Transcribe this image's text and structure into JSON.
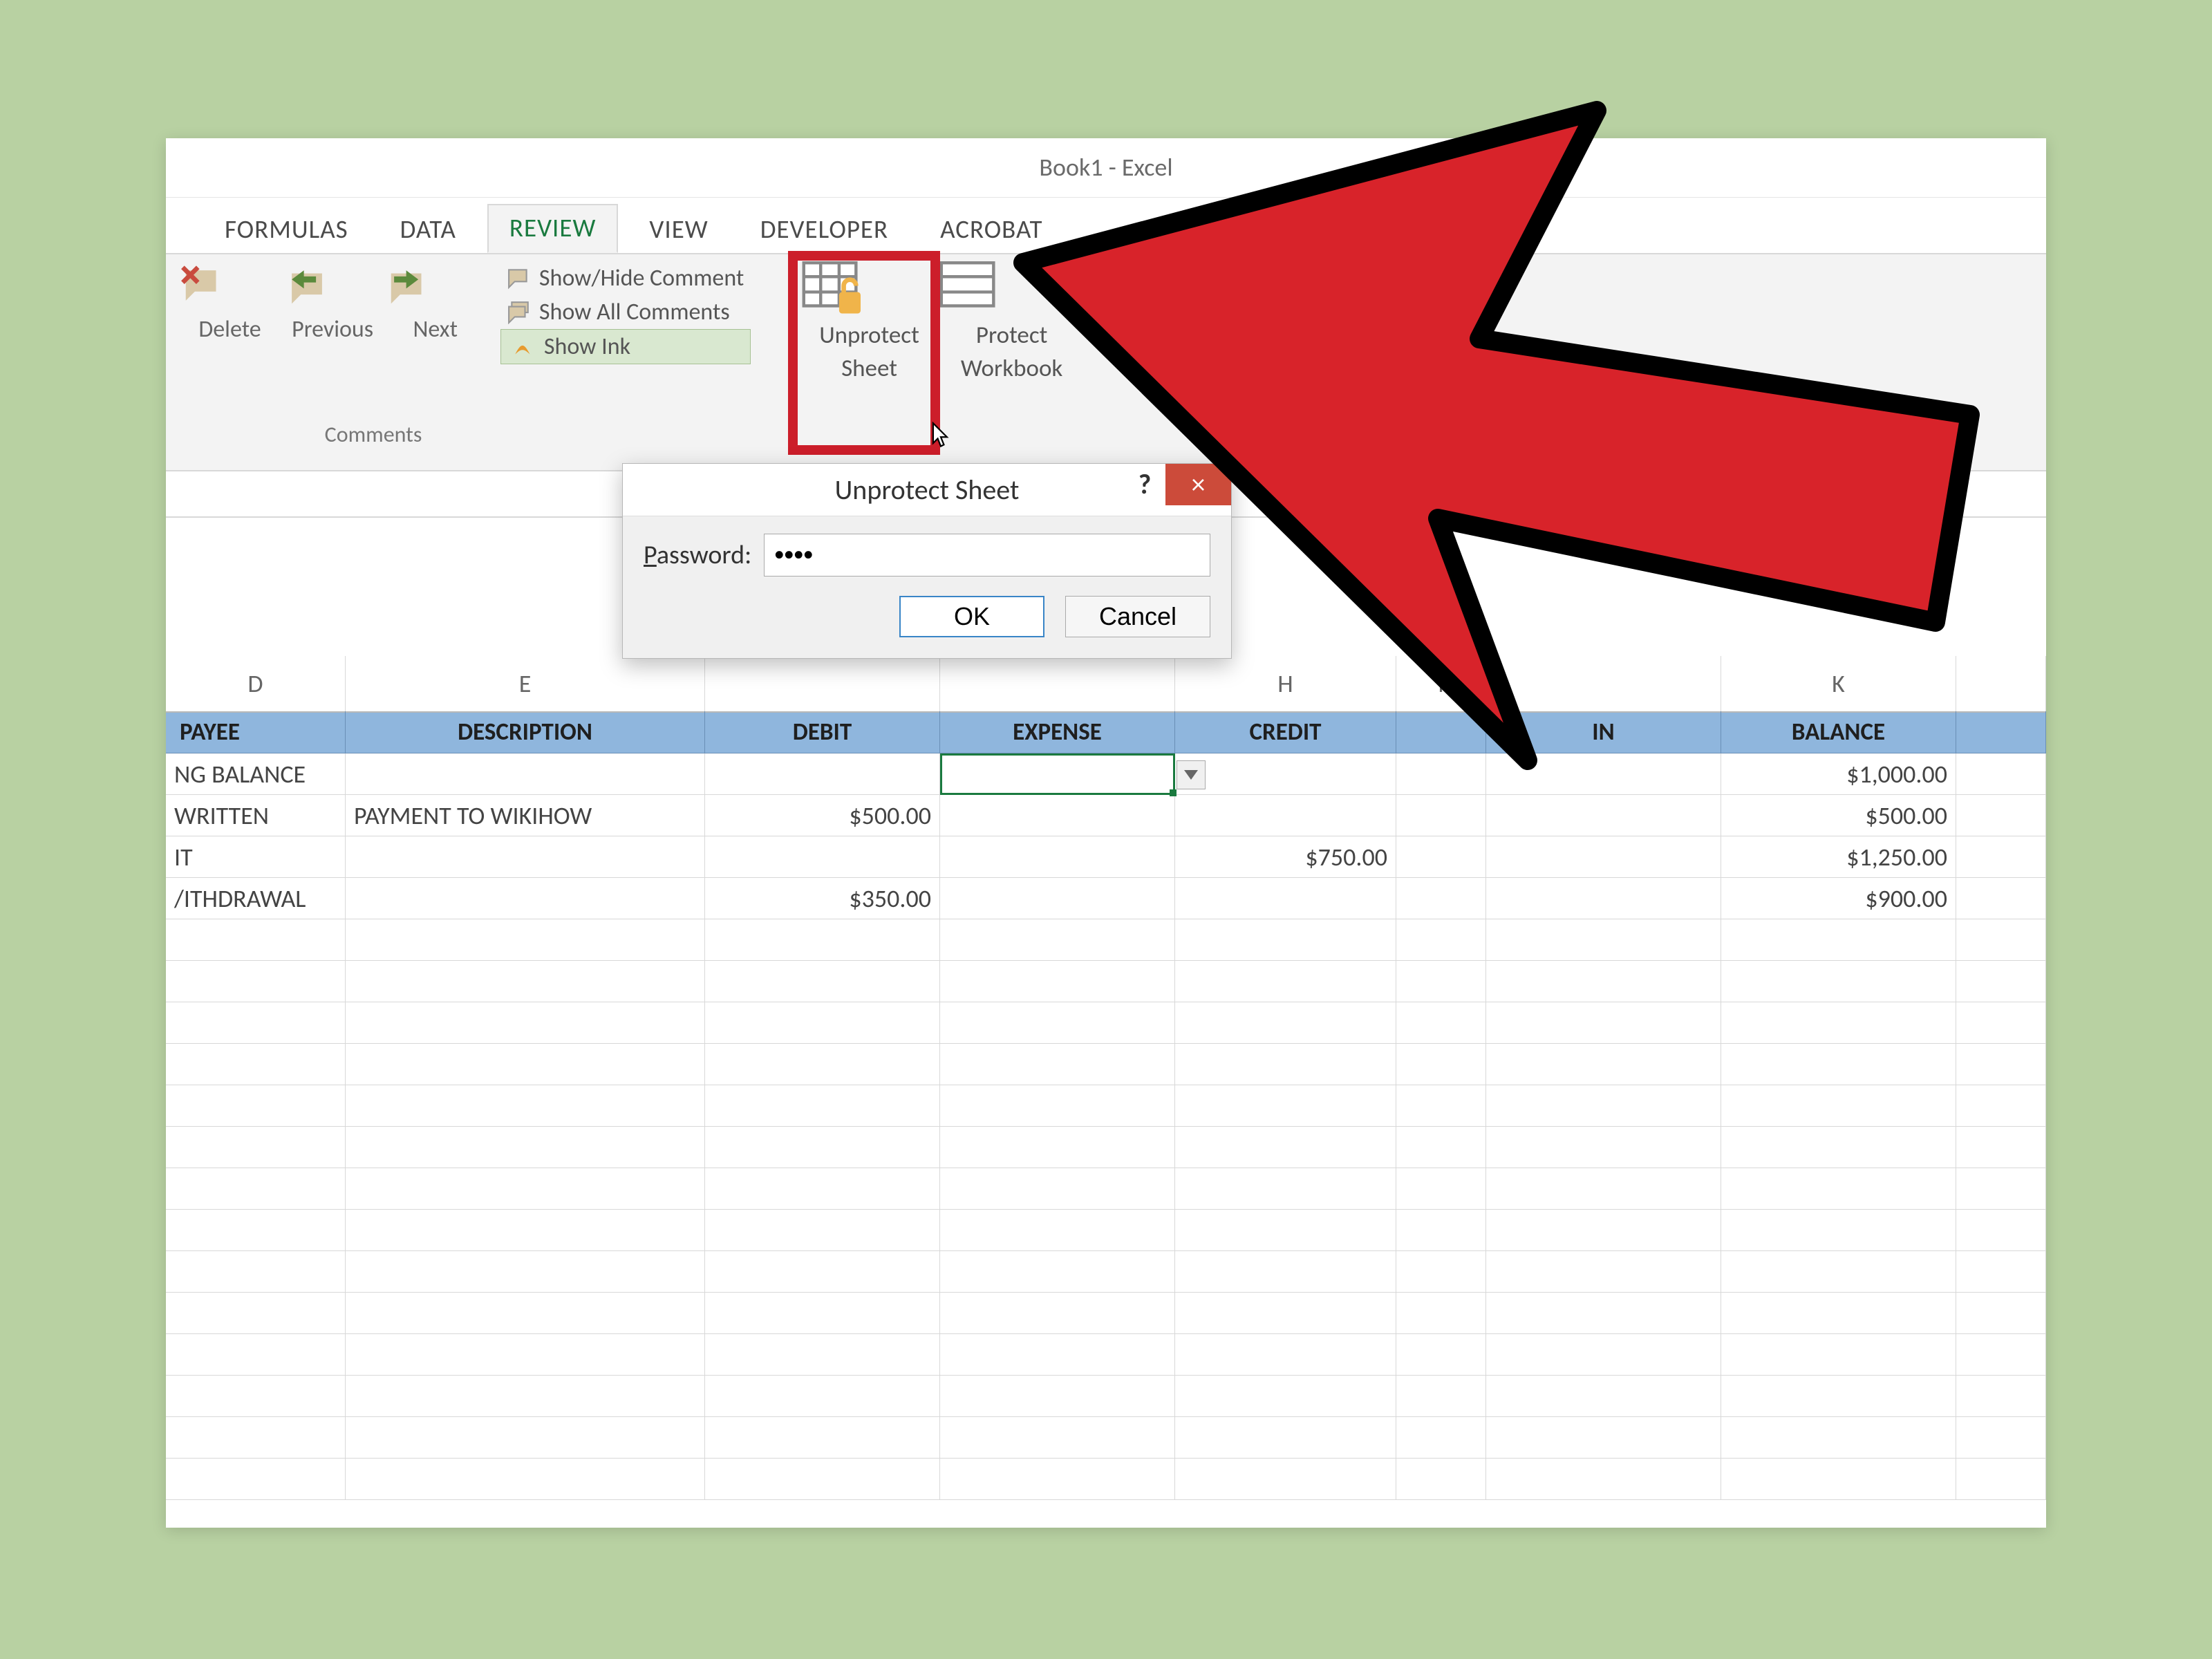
{
  "title": "Book1 - Excel",
  "tabs": {
    "formulas": "FORMULAS",
    "data": "DATA",
    "review": "REVIEW",
    "view": "VIEW",
    "developer": "DEVELOPER",
    "acrobat": "ACROBAT"
  },
  "ribbon": {
    "comments": {
      "delete": "Delete",
      "previous": "Previous",
      "next": "Next",
      "show_hide": "Show/Hide Comment",
      "show_all": "Show All Comments",
      "show_ink": "Show Ink",
      "group_label": "Comments"
    },
    "protect": {
      "unprotect_sheet_l1": "Unprotect",
      "unprotect_sheet_l2": "Sheet",
      "protect_workbook_l1": "Protect",
      "protect_workbook_l2": "Workbook"
    }
  },
  "dialog": {
    "title": "Unprotect Sheet",
    "help": "?",
    "close": "×",
    "password_label_pre": "P",
    "password_label_rest": "assword:",
    "password_value": "••••",
    "ok": "OK",
    "cancel": "Cancel"
  },
  "columns": {
    "D": "D",
    "E": "E",
    "H": "H",
    "I": "I",
    "K": "K"
  },
  "headers": {
    "payee": "PAYEE",
    "description": "DESCRIPTION",
    "debit": "DEBIT",
    "expense": "EXPENSE",
    "credit": "CREDIT",
    "in": "IN",
    "balance": "BALANCE"
  },
  "rows": [
    {
      "payee": "NG BALANCE",
      "description": "",
      "debit": "",
      "expense": "",
      "credit": "",
      "balance": "$1,000.00"
    },
    {
      "payee": "WRITTEN",
      "description": "PAYMENT TO WIKIHOW",
      "debit": "$500.00",
      "expense": "",
      "credit": "",
      "balance": "$500.00"
    },
    {
      "payee": "IT",
      "description": "",
      "debit": "",
      "expense": "",
      "credit": "$750.00",
      "balance": "$1,250.00"
    },
    {
      "payee": "/ITHDRAWAL",
      "description": "",
      "debit": "$350.00",
      "expense": "",
      "credit": "",
      "balance": "$900.00"
    }
  ]
}
